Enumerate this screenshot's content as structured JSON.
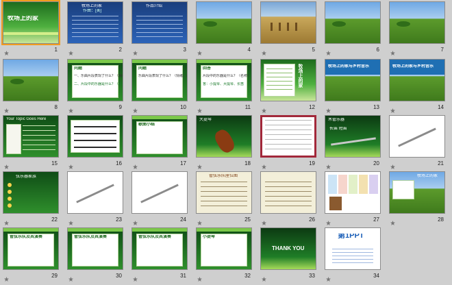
{
  "slides": [
    {
      "n": "1",
      "kind": "title",
      "title": "牧场上的家",
      "selected": true
    },
    {
      "n": "2",
      "kind": "blue",
      "title": "牧场上的家",
      "subtitle": "作曲：[美]"
    },
    {
      "n": "3",
      "kind": "blue",
      "title": "作品介绍"
    },
    {
      "n": "4",
      "kind": "field"
    },
    {
      "n": "5",
      "kind": "dry"
    },
    {
      "n": "6",
      "kind": "field"
    },
    {
      "n": "7",
      "kind": "field"
    },
    {
      "n": "8",
      "kind": "field"
    },
    {
      "n": "9",
      "kind": "text",
      "title": "问题",
      "line1": "一、乐曲片段表现了什么？（情绪、画面）",
      "line2": "二、片段中的乐器是什么？（名称）"
    },
    {
      "n": "10",
      "kind": "text",
      "title": "问题",
      "line1": "乐曲片段表现了什么？（情绪、画面）"
    },
    {
      "n": "11",
      "kind": "text",
      "title": "回答",
      "line1": "片段中的乐器是什么？（名称）",
      "line2": "答：小提琴、大提琴、长笛"
    },
    {
      "n": "12",
      "kind": "side",
      "title": "牧场上的家"
    },
    {
      "n": "13",
      "kind": "banner",
      "title": "牧场上的家与乡村音乐"
    },
    {
      "n": "14",
      "kind": "banner",
      "title": "牧场上的家与乡村音乐"
    },
    {
      "n": "15",
      "kind": "music",
      "title": "Your Topic Goes Here"
    },
    {
      "n": "16",
      "kind": "score"
    },
    {
      "n": "17",
      "kind": "text",
      "title": "歌曲小结"
    },
    {
      "n": "18",
      "kind": "violin",
      "title": "大提琴"
    },
    {
      "n": "19",
      "kind": "framed"
    },
    {
      "n": "20",
      "kind": "flute",
      "title": "木管乐器",
      "line1": "长笛  短笛"
    },
    {
      "n": "21",
      "kind": "white"
    },
    {
      "n": "22",
      "kind": "strings",
      "title": "弦乐器家族"
    },
    {
      "n": "23",
      "kind": "white"
    },
    {
      "n": "24",
      "kind": "white"
    },
    {
      "n": "25",
      "kind": "paper",
      "title": "管弦乐队座位图"
    },
    {
      "n": "26",
      "kind": "paper"
    },
    {
      "n": "27",
      "kind": "photo"
    },
    {
      "n": "28",
      "kind": "horses",
      "title": "牧场上的家"
    },
    {
      "n": "29",
      "kind": "text",
      "title": "管弦乐队及其演奏"
    },
    {
      "n": "30",
      "kind": "text",
      "title": "管弦乐队及其演奏"
    },
    {
      "n": "31",
      "kind": "text",
      "title": "管弦乐队及其演奏"
    },
    {
      "n": "32",
      "kind": "text",
      "title": "小提琴"
    },
    {
      "n": "33",
      "kind": "thanks",
      "title": "THANK YOU"
    },
    {
      "n": "34",
      "kind": "logo",
      "title": "第1PPT"
    }
  ],
  "colors": {
    "selected": "#f29c1f",
    "background": "#cfcfcf",
    "green": "#2f8f2c"
  }
}
